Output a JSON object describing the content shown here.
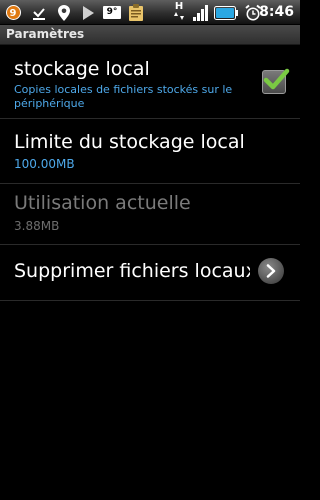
{
  "status_bar": {
    "notification_count": "9",
    "weather_temp": "9°",
    "clock": "8:46",
    "icons": [
      "notification-badge-icon",
      "download-done-icon",
      "location-pin-icon",
      "play-icon",
      "weather-icon",
      "clipboard-icon",
      "hspa-signal-icon",
      "signal-strength-icon",
      "battery-icon",
      "alarm-icon"
    ],
    "hspa_label": "H"
  },
  "title_bar": {
    "title": "Paramètres"
  },
  "preferences": [
    {
      "title": "stockage local",
      "summary": "Copies locales de fichiers stockés sur le périphérique",
      "checked": true
    },
    {
      "title": "Limite du stockage local",
      "summary": "100.00MB"
    },
    {
      "title": "Utilisation actuelle",
      "summary": "3.88MB",
      "enabled": false
    },
    {
      "title": "Supprimer fichiers locaux"
    }
  ],
  "colors": {
    "summary_blue": "#4ea9ea",
    "check_green": "#7ac943",
    "disabled_gray": "#7a7a7a"
  }
}
